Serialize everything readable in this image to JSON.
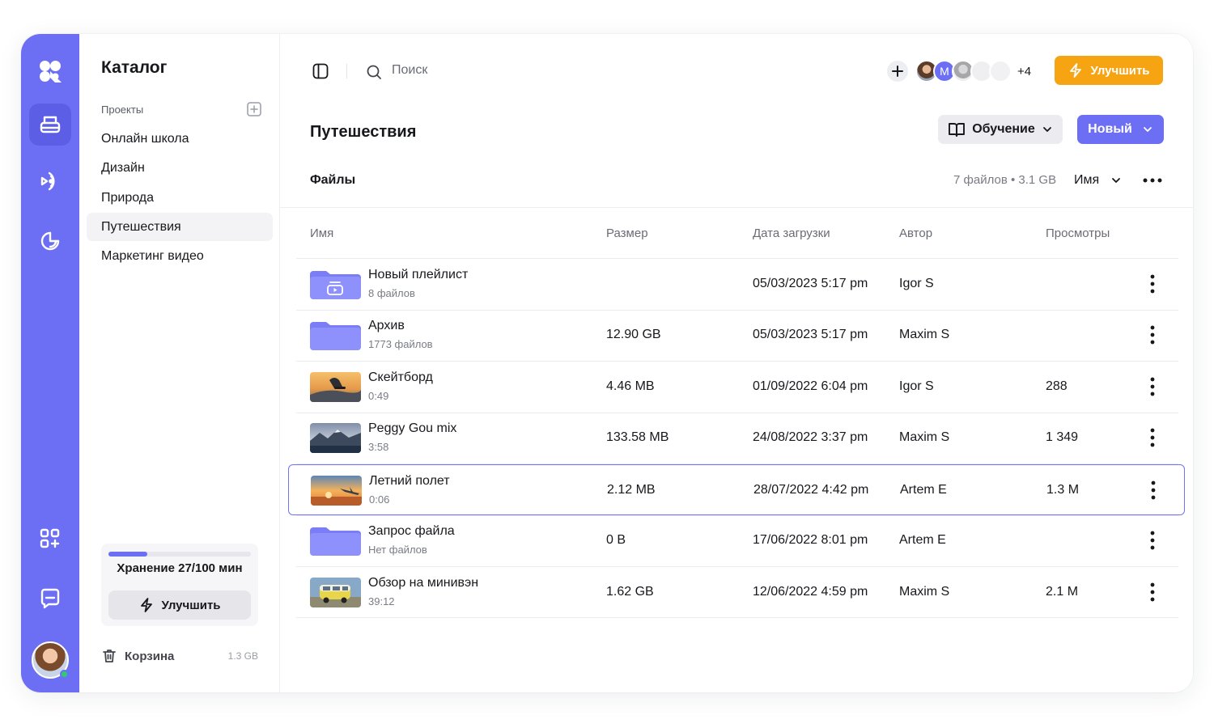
{
  "sidebar": {
    "title": "Каталог",
    "section_label": "Проекты",
    "projects": [
      "Онлайн школа",
      "Дизайн",
      "Природа",
      "Путешествия",
      "Маркетинг видео"
    ],
    "active_project": "Путешествия",
    "storage": {
      "label": "Хранение 27/100 мин",
      "used_fraction": 0.27,
      "upgrade_label": "Улучшить"
    },
    "trash": {
      "label": "Корзина",
      "size": "1.3 GB"
    }
  },
  "toolbar": {
    "search_placeholder": "Поиск",
    "collaborator_initial": "M",
    "more_collaborators": "+4",
    "upgrade_label": "Улучшить"
  },
  "page": {
    "title": "Путешествия",
    "learn_label": "Обучение",
    "new_label": "Новый",
    "files_label": "Файлы",
    "files_meta": "7 файлов • 3.1 GB",
    "sort_label": "Имя"
  },
  "table": {
    "columns": [
      "Имя",
      "Размер",
      "Дата загрузки",
      "Автор",
      "Просмотры"
    ],
    "rows": [
      {
        "name": "Новый плейлист",
        "sub": "8 файлов",
        "size": "",
        "date": "05/03/2023 5:17 pm",
        "author": "Igor S",
        "views": "",
        "thumb": "playlist-folder"
      },
      {
        "name": "Архив",
        "sub": "1773 файлов",
        "size": "12.90 GB",
        "date": "05/03/2023 5:17 pm",
        "author": "Maxim S",
        "views": "",
        "thumb": "folder"
      },
      {
        "name": "Скейтборд",
        "sub": "0:49",
        "size": "4.46 MB",
        "date": "01/09/2022 6:04 pm",
        "author": "Igor S",
        "views": "288",
        "thumb": "skate"
      },
      {
        "name": "Peggy Gou mix",
        "sub": "3:58",
        "size": "133.58 MB",
        "date": "24/08/2022 3:37 pm",
        "author": "Maxim S",
        "views": "1 349",
        "thumb": "mountains"
      },
      {
        "name": "Летний полет",
        "sub": "0:06",
        "size": "2.12 MB",
        "date": "28/07/2022 4:42 pm",
        "author": "Artem E",
        "views": "1.3 M",
        "thumb": "sunset"
      },
      {
        "name": "Запрос файла",
        "sub": "Нет файлов",
        "size": "0 B",
        "date": "17/06/2022 8:01 pm",
        "author": "Artem E",
        "views": "",
        "thumb": "folder"
      },
      {
        "name": "Обзор на минивэн",
        "sub": "39:12",
        "size": "1.62 GB",
        "date": "12/06/2022 4:59 pm",
        "author": "Maxim S",
        "views": "2.1 M",
        "thumb": "van"
      }
    ],
    "selected_index": 4
  },
  "colors": {
    "accent": "#6c6ff4",
    "upgrade": "#f7a412",
    "folder": "#8a8cfa"
  }
}
